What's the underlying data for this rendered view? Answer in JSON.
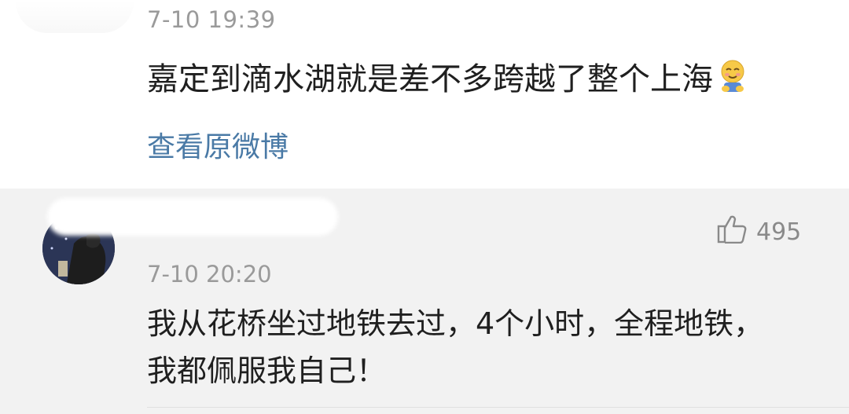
{
  "post": {
    "time": "7-10 19:39",
    "text": "嘉定到滴水湖就是差不多跨越了整个上海",
    "emoji": "hiding-face-emoji",
    "view_original": "查看原微博"
  },
  "comment": {
    "like_icon": "thumbs-up-icon",
    "like_count": "495",
    "time": "7-10 20:20",
    "text": "我从花桥坐过地铁去过，4个小时，全程地铁，我都佩服我自己！"
  },
  "colors": {
    "link": "#4a7aa6",
    "meta": "#9a9a9a",
    "text": "#1f1f1f",
    "comment_bg": "#f2f2f2"
  }
}
